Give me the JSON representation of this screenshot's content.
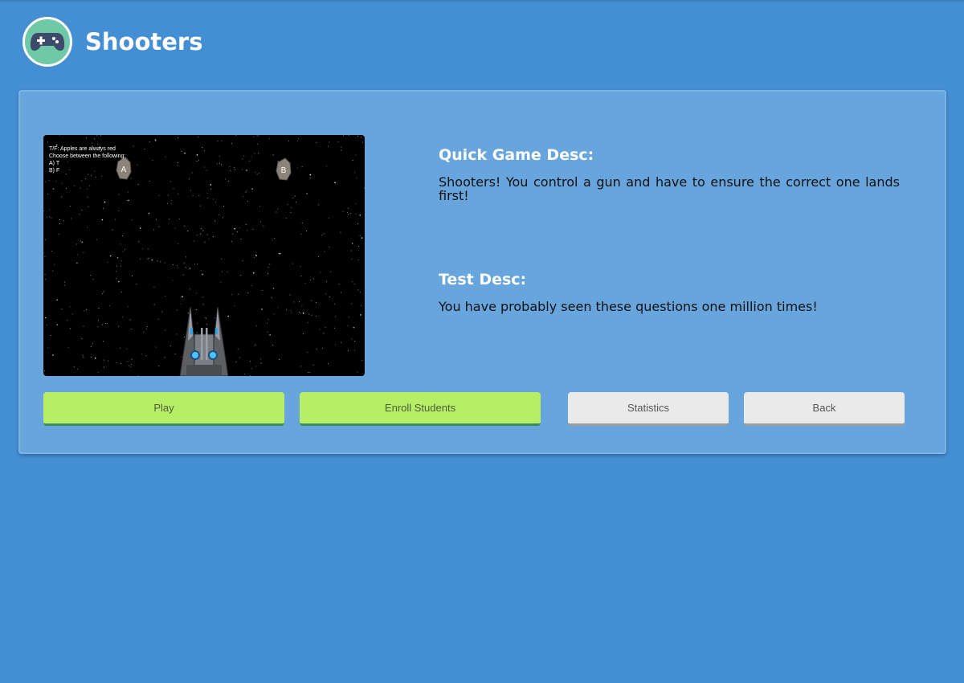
{
  "header": {
    "title": "Shooters",
    "logo_icon": "gamepad-icon",
    "logo_color": "#6fc8a8"
  },
  "game_preview": {
    "question": "T/F: Apples are always red",
    "prompt": "Choose between the following:",
    "options": [
      "A) T",
      "B) F"
    ],
    "targets": [
      "A",
      "B"
    ]
  },
  "descriptions": {
    "game_heading": "Quick Game Desc:",
    "game_text": "Shooters! You control a gun and have to ensure the correct one lands first!",
    "test_heading": "Test Desc:",
    "test_text": "You have probably seen these questions one million times!"
  },
  "buttons": {
    "play": "Play",
    "enroll": "Enroll Students",
    "statistics": "Statistics",
    "back": "Back"
  },
  "colors": {
    "background": "#448ed3",
    "panel": "#67a5dc",
    "primary_button": "#b6ee66",
    "secondary_button": "#eaeaea"
  }
}
